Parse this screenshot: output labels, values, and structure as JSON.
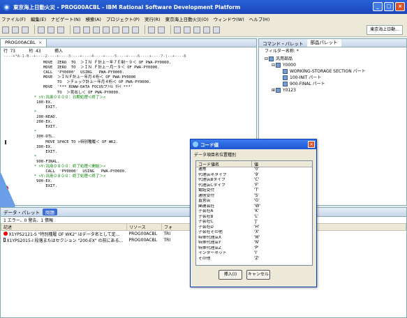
{
  "window": {
    "title": "東京海上日動火災 - PROG00ACBL - IBM Rational Software Development Platform"
  },
  "menu": [
    "ファイル(F)",
    "編集(E)",
    "ナビゲート(N)",
    "検索(A)",
    "プロジェクト(P)",
    "実行(R)",
    "東京海上日動火災(O)",
    "ウィンドウ(W)",
    "ヘルプ(H)"
  ],
  "perspective": "東京海上日動...",
  "editor": {
    "tab": "PROG00ACBL",
    "row_label": "行 73",
    "col_label": "桁 43",
    "mode": "挿入",
    "ruler": "----+*A-1-B--+----2----+----3----+----4----+----5----+----6----+----7-|--+----8",
    "code_lines": [
      "          MOVE  ZERO  TO  ＞ＩＮ Ｆ計上－年７Ｅ制－９＜ OF PWA-PY0000.",
      "          MOVE  ZERO  TO  ＞ＩＮ Ｆ計上－月－９＜ OF PWA-PY0000.",
      "          CALL  'PY0000'  USING   PWA-PY0000.",
      "          MOVE  ＞ＩＮＦ計上－年月４桁＜ OF PWA-PY0000",
      "                TO  ＞チェック計上－年月４桁＜ OF PWA-PY0000.",
      "          MOVE  '*** ROWW-DATA FOCUSフｧｲﾙ ﾀﾃｲ ***'",
      "                TO  ＞見出し＜ OF PWA-PY0000.",
      "      * >Y:汎用００００：日期処理＜終了＞<",
      "       100-EX.",
      "           EXIT.",
      "      *",
      "       200-READ.",
      "       200-EX.",
      "           EXIT.",
      "      *",
      "       300-DTL.",
      "           MOVE SPACE TO >特別種履＜ OF WK2.",
      "       300-EX.",
      "           EXIT.",
      "      *",
      "       900-FINAL.",
      "      * >Y:汎用０８００：終了処理＜開始＞<",
      "           CALL  'PY0000'  USING   PWA-PY0000.",
      "      * >Y:汎用０８００：終了処理＜終了＞<",
      "       900-EX.",
      "           EXIT."
    ]
  },
  "right_pane": {
    "tabs": [
      "コマンド・パレット",
      "部品パレット"
    ],
    "filter_label": "フィルター名称: *",
    "tree": [
      {
        "label": "汎用部品",
        "level": 0,
        "expander": "⊟"
      },
      {
        "label": "Y0000",
        "level": 1,
        "expander": "⊟"
      },
      {
        "label": "WORKING-STORAGE SECTION パート",
        "level": 2,
        "expander": ""
      },
      {
        "label": "100-INIT パート",
        "level": 2,
        "expander": ""
      },
      {
        "label": "900-FINAL パート",
        "level": 2,
        "expander": ""
      },
      {
        "label": "Y0123",
        "level": 1,
        "expander": "⊞"
      }
    ]
  },
  "bottom": {
    "tabs": [
      "データ・パレット",
      "問題"
    ],
    "summary": "1 エラー、0 警告、1 情報",
    "columns": [
      "記述",
      "リソース",
      "フォ"
    ],
    "rows": [
      {
        "severity": "error",
        "desc": "X1YPS2121-S \"特別種履 OF WK2\" はデータ名として定…",
        "resource": "PROG00ACBL",
        "folder": "TRI"
      },
      {
        "severity": "info",
        "desc": "X1YPS2015-I 段落またはセクション \"200-EX\" の前にある…",
        "resource": "PROG00ACBL",
        "folder": "TRI"
      }
    ]
  },
  "dialog": {
    "title": "コード値",
    "label": "データ項目名位置種別",
    "col_name": "コード値名",
    "col_value": "値",
    "rows": [
      {
        "name": "通常",
        "value": "'0'"
      },
      {
        "name": "代理店ネタイプ",
        "value": "'9'"
      },
      {
        "name": "代理店Bタイプ",
        "value": "'C'"
      },
      {
        "name": "代理店Cタイプ",
        "value": "'F'"
      },
      {
        "name": "電話受付",
        "value": "'T'"
      },
      {
        "name": "通信受付",
        "value": "'S'"
      },
      {
        "name": "直営店",
        "value": "'G'"
      },
      {
        "name": "関連会社",
        "value": "'W'"
      },
      {
        "name": "子会社A",
        "value": "'K'"
      },
      {
        "name": "子会社B",
        "value": "'L'"
      },
      {
        "name": "子会社C",
        "value": "'J'"
      },
      {
        "name": "子会社D",
        "value": "'H'"
      },
      {
        "name": "子会社その他",
        "value": "'X'"
      },
      {
        "name": "特殊代理店X",
        "value": "'M'"
      },
      {
        "name": "特殊代理店Y",
        "value": "'N'"
      },
      {
        "name": "特殊代理店Z",
        "value": "'P'"
      },
      {
        "name": "インターネット",
        "value": "'I'"
      },
      {
        "name": "その他",
        "value": "'Z'"
      }
    ],
    "ok": "挿入(I)",
    "cancel": "キャンセル"
  }
}
